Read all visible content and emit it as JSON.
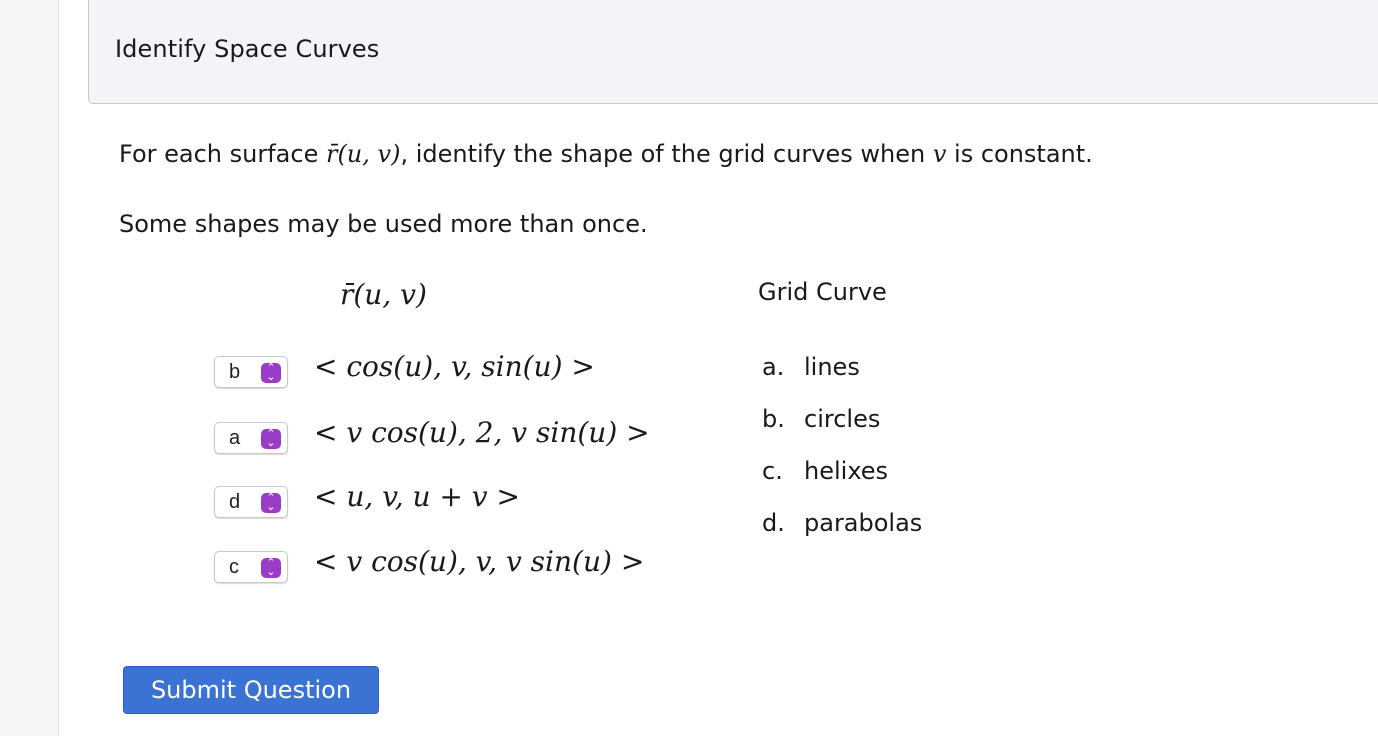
{
  "header": {
    "title": "Identify Space Curves"
  },
  "prompt": {
    "p1_a": "For each surface ",
    "p1_math": "r̄(u, v)",
    "p1_b": ", identify the shape of the grid curves when ",
    "p1_var": "v",
    "p1_c": " is constant.",
    "p2": "Some shapes may be used more than once."
  },
  "columns": {
    "left": "r̄(u, v)",
    "right": "Grid Curve"
  },
  "rows": [
    {
      "selected": "b",
      "expr": "< cos(u), v, sin(u) >"
    },
    {
      "selected": "a",
      "expr": "< v cos(u), 2, v sin(u) >"
    },
    {
      "selected": "d",
      "expr": "< u, v, u + v >"
    },
    {
      "selected": "c",
      "expr": "< v cos(u), v, v sin(u) >"
    }
  ],
  "options": [
    {
      "letter": "a.",
      "label": "lines"
    },
    {
      "letter": "b.",
      "label": "circles"
    },
    {
      "letter": "c.",
      "label": "helixes"
    },
    {
      "letter": "d.",
      "label": "parabolas"
    }
  ],
  "submit_label": "Submit Question",
  "colors": {
    "accent": "#3b73d5",
    "select_arrow": "#9b3cc9",
    "header_bg": "#f3f3f8"
  },
  "icons": {
    "select_arrow": "updown-chevron-icon"
  }
}
